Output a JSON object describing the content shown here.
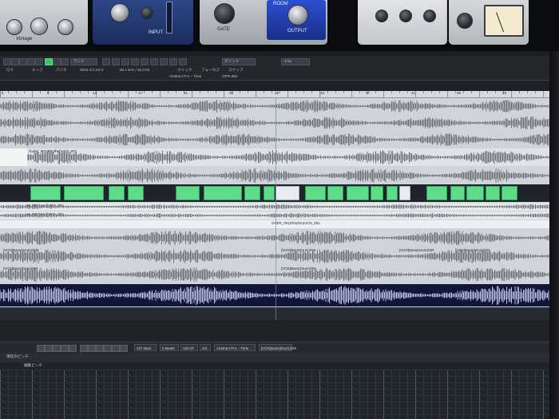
{
  "plugins": {
    "plugin_1_brand": "Vintage",
    "plugin_2_label": "INPUT",
    "plugin_3_gate": "GATE",
    "plugin_3_output": "OUTPUT",
    "plugin_3_room": "ROOM"
  },
  "toolbar": {
    "dropdown_1": "ランド",
    "field_1": "0003 4/4 1/2 0",
    "field_2": "86.1 kHz / 32.0 bit",
    "field_3": "Abstract Pro – Time",
    "grid_dropdown": "グリッド",
    "grid_value": "1/16",
    "row1_labels": [
      "ロケ",
      "ループ",
      "パンチ",
      "クリック",
      "フォーカス",
      "スナップ"
    ],
    "row2_labels": [
      "Abstract Pro – Time",
      "OFFLINE"
    ]
  },
  "ruler": {
    "numbers": [
      "5",
      "9",
      "13",
      "17",
      "21",
      "25",
      "29",
      "33",
      "37",
      "41",
      "45",
      "49"
    ]
  },
  "tracks": {
    "track_3_clip": "Guitar_001(Rhythm)VOX_001",
    "track_6_clip_a": "Vo_001(Lead)VOX_001",
    "track_6_clip_b": "Vo_001(Lead)VOX_001",
    "track_7_clip": "OVER_001(Rhythm)VOX_001",
    "track_8_clip": "[VOX]Bass(Drum)/SR",
    "track_9_clip_a": "[VOX]Bass(Drum)/SR",
    "track_9_clip_b": "[VOX]Bass(Drum)/SR",
    "track_9_clip_c": "[VOX]Bass(Drum)/SR",
    "track_10_clip_a": "[VOX]Bass(Drum)/SR",
    "track_10_clip_b": "[VOX]Bass(Drum)/SR"
  },
  "transport": {
    "tempo": "137 Bars",
    "position": "0 Beats",
    "tempo_bpm": "120.07",
    "signature": "4/4",
    "timebase": "Abstract Pro – Time",
    "clip_name": "[VOX]Bass(Drum)/SR"
  },
  "lower": {
    "tab_1": "現在のピッチ",
    "tab_2": "編集ピッチ"
  },
  "colors": {
    "accent_green": "#5fdc8a",
    "waveform": "#6b7077",
    "background": "#cfd4da"
  }
}
